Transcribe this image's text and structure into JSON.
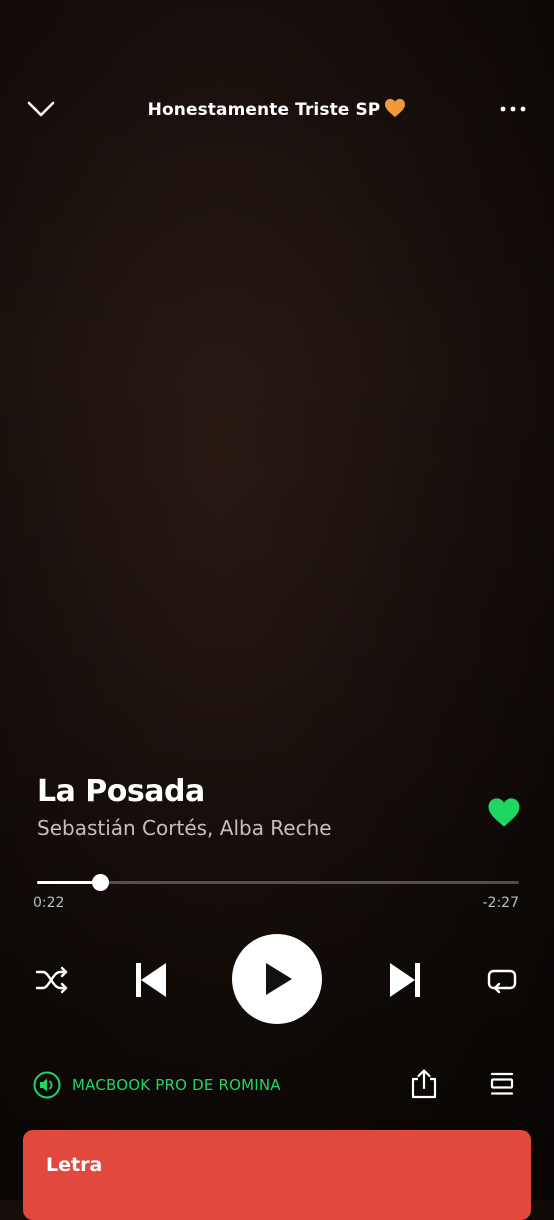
{
  "header": {
    "playlist_title": "Honestamente Triste SP",
    "title_emoji": "🧡"
  },
  "track": {
    "title": "La Posada",
    "artists": "Sebastián Cortés, Alba Reche",
    "liked": true
  },
  "progress": {
    "elapsed": "0:22",
    "remaining": "-2:27",
    "fraction": 0.13
  },
  "device": {
    "label": "MACBOOK PRO DE ROMINA"
  },
  "lyrics": {
    "label": "Letra"
  },
  "colors": {
    "accent_green": "#1ed760",
    "lyrics_card": "#e1493f",
    "heart_orange": "#f29a3b"
  },
  "icons": [
    "chevron-down-icon",
    "more-options-icon",
    "heart-icon",
    "shuffle-icon",
    "previous-icon",
    "play-icon",
    "next-icon",
    "repeat-icon",
    "speaker-icon",
    "share-icon",
    "queue-icon"
  ]
}
